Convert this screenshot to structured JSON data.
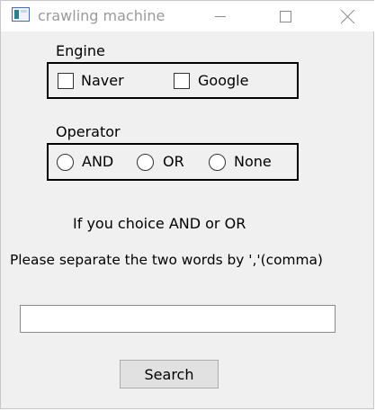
{
  "window": {
    "title": "crawling machine"
  },
  "engine": {
    "label": "Engine",
    "options": [
      "Naver",
      "Google"
    ]
  },
  "operator": {
    "label": "Operator",
    "options": [
      "AND",
      "OR",
      "None"
    ]
  },
  "info": {
    "line1": "If you choice AND or OR",
    "line2": "Please separate the two words by ','(comma)"
  },
  "search": {
    "input_value": "",
    "button_label": "Search"
  }
}
